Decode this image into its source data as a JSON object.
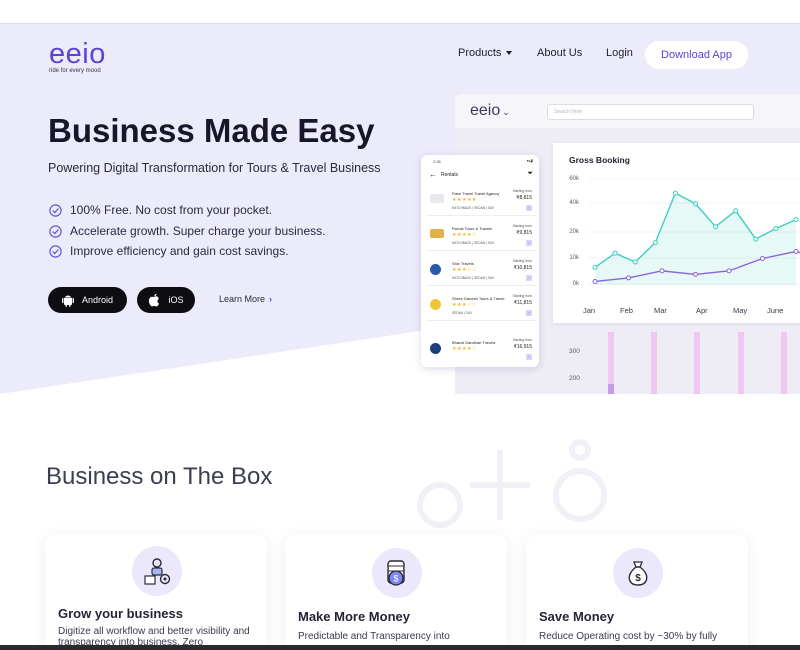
{
  "brand": {
    "name": "eeio",
    "tagline": "ride for every mood",
    "accent": "#5b44d4"
  },
  "nav": {
    "products": "Products",
    "about": "About Us",
    "login": "Login",
    "download": "Download App"
  },
  "hero": {
    "title": "Business Made Easy",
    "subtitle": "Powering Digital Transformation for Tours & Travel Business",
    "features": [
      "100% Free. No cost from your pocket.",
      "Accelerate growth. Super charge your business.",
      "Improve efficiency and gain cost savings."
    ],
    "android": "Android",
    "ios": "iOS",
    "learn_more": "Learn More"
  },
  "dashboard": {
    "logo": "eeio",
    "search_placeholder": "Search Here",
    "extra_ticks": [
      "300",
      "200"
    ]
  },
  "chart_data": {
    "type": "line",
    "title": "Gross Booking",
    "categories": [
      "Jan",
      "Feb",
      "Mar",
      "Apr",
      "May",
      "June"
    ],
    "yticks": [
      "60k",
      "40k",
      "20k",
      "10k",
      "0k"
    ],
    "series": [
      {
        "color": "#3ccfbe",
        "values": [
          10,
          18,
          13,
          24,
          52,
          46,
          33,
          42,
          26,
          32,
          37
        ]
      },
      {
        "color": "#8b63d9",
        "values": [
          2,
          4,
          8,
          6,
          8,
          15,
          19,
          14,
          17
        ]
      }
    ]
  },
  "phone": {
    "time": "2:36",
    "title": "Rentals",
    "starting_label": "Starting from",
    "agencies": [
      {
        "name": "Flare Travel Travel Agency",
        "stars": "★★★★★",
        "price": "₹8,815",
        "types": "HATCHBACK  |  SEDAN  |  SUV"
      },
      {
        "name": "Ronak Tours & Travels",
        "stars": "★★★★☆",
        "price": "₹9,815",
        "types": "HATCHBACK  |  SEDAN  |  SUV"
      },
      {
        "name": "Shiv Travels",
        "stars": "★★★☆☆",
        "price": "₹10,815",
        "types": "HATCHBACK  |  SEDAN  |  SUV"
      },
      {
        "name": "Shree Ganesh Tours & Travel",
        "stars": "★★★☆☆",
        "price": "₹11,815",
        "types": "SEDAN  |  SUV"
      },
      {
        "name": "Bharat Gandhari Travels",
        "stars": "★★★★☆",
        "price": "₹16,915",
        "types": ""
      }
    ]
  },
  "section": {
    "title": "Business on The Box",
    "cards": [
      {
        "title": "Grow your business",
        "desc": "Digitize all workflow and better visibility and transparency into business. Zero"
      },
      {
        "title": "Make More Money",
        "desc": "Predictable and Transparency into"
      },
      {
        "title": "Save Money",
        "desc": "Reduce Operating cost by ~30% by fully"
      }
    ]
  }
}
